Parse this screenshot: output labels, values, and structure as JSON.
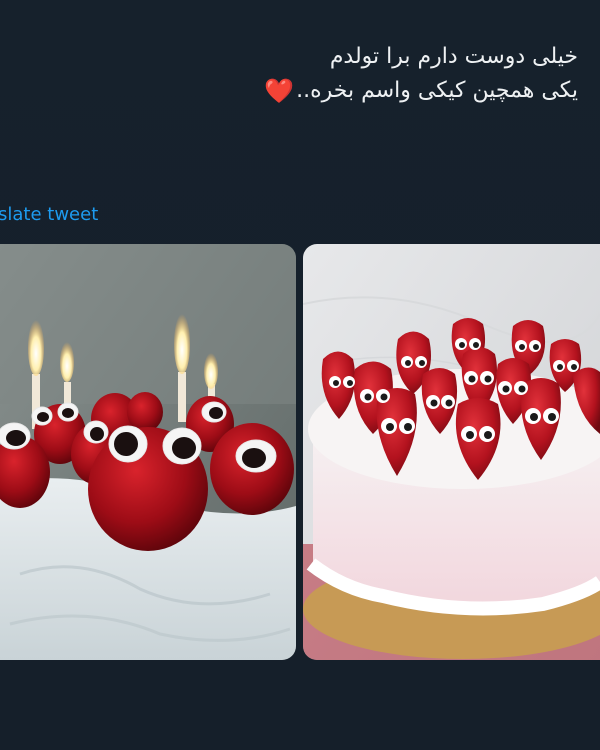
{
  "tweet": {
    "text_line_1": "خیلی دوست دارم برا تولدم",
    "text_line_2": "یکی همچین کیکی واسم بخره..",
    "heart_emoji": "❤️",
    "heart_color": "#e0245e"
  },
  "translate": {
    "label": "slate tweet",
    "link_color": "#1d9bf0"
  },
  "media": {
    "images": [
      {
        "description": "Cake with googly-eyed strawberries and lit candles"
      },
      {
        "description": "White frosted cake topped with googly-eyed strawberries"
      }
    ]
  },
  "theme": {
    "background": "#15202b",
    "text_color": "#e7e9ea"
  }
}
